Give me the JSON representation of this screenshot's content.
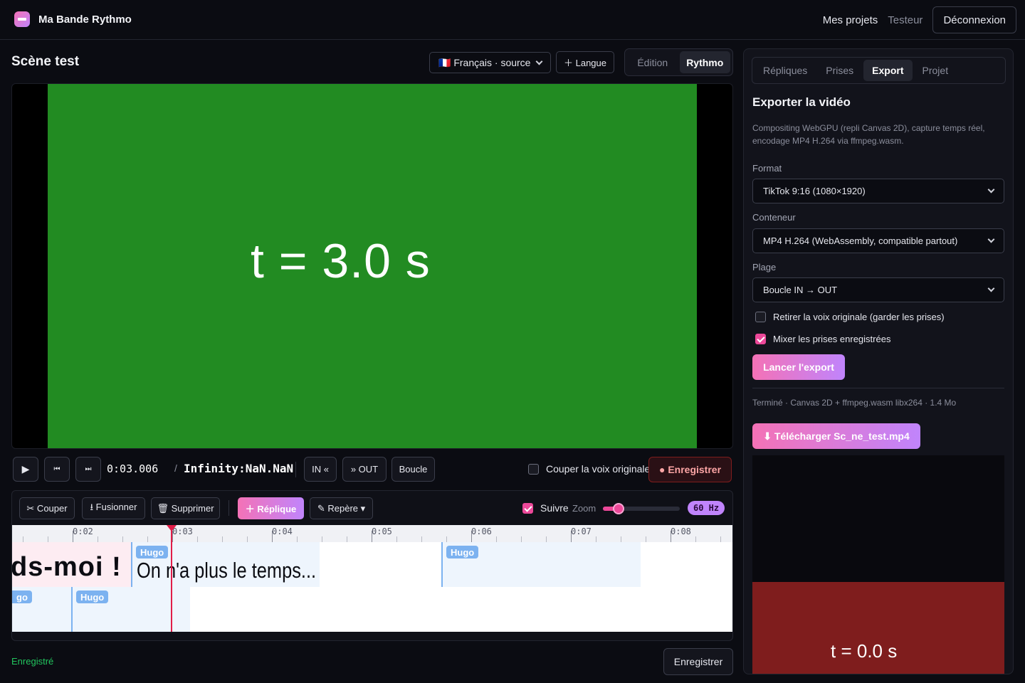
{
  "header": {
    "app_title": "Ma Bande Rythmo",
    "nav_projects": "Mes projets",
    "user_name": "Testeur",
    "logout_label": "Déconnexion"
  },
  "scene": {
    "title": "Scène test",
    "language_select_value": "🇫🇷 Français · source",
    "add_language_label": "＋ Langue",
    "mode_tabs": [
      "Édition",
      "Rythmo"
    ],
    "active_mode": "Rythmo"
  },
  "video": {
    "overlay_text": "t = 3.0 s",
    "background_color": "#228b22"
  },
  "transport": {
    "play_icon": "▶",
    "prev_icon": "⏮",
    "next_icon": "⏭",
    "current_time": "0:03.006",
    "separator": "/",
    "duration": "Infinity:NaN.NaN",
    "in_label": "IN «",
    "out_label": "» OUT",
    "loop_label": "Boucle",
    "mute_original_label": "Couper la voix originale",
    "mute_original_checked": false,
    "record_label": "● Enregistrer"
  },
  "timeline": {
    "cut_label": "✂ Couper",
    "merge_label": "⭳ Fusionner",
    "delete_label": "🗑 Supprimer",
    "add_line_label": "＋ Réplique",
    "marker_label": "✎ Repère ▾",
    "follow_label": "Suivre",
    "follow_checked": true,
    "zoom_label": "Zoom",
    "zoom_level": 0.2,
    "fps_badge": "60 Hz",
    "ruler_ticks": [
      "0:02",
      "0:03",
      "0:04",
      "0:05",
      "0:06",
      "0:07",
      "0:08"
    ],
    "playhead_time": "0:03.006",
    "lane1_text_a": "ds-moi !",
    "lane1_text_b": "On n'a plus le temps...",
    "clip_tag": "Hugo",
    "clip_tag_partial": "go"
  },
  "footer": {
    "save_status": "Enregistré",
    "save_label": "Enregistrer"
  },
  "sidebar": {
    "tabs": [
      "Répliques",
      "Prises",
      "Export",
      "Projet"
    ],
    "active_tab": "Export",
    "export_title": "Exporter la vidéo",
    "export_description": "Compositing WebGPU (repli Canvas 2D), capture temps réel, encodage MP4 H.264 via ffmpeg.wasm.",
    "format_label": "Format",
    "format_value": "TikTok 9:16 (1080×1920)",
    "container_label": "Conteneur",
    "container_value": "MP4 H.264 (WebAssembly, compatible partout)",
    "range_label": "Plage",
    "range_value": "Boucle IN → OUT",
    "remove_voice_label": "Retirer la voix originale (garder les prises)",
    "remove_voice_checked": false,
    "mix_takes_label": "Mixer les prises enregistrées",
    "mix_takes_checked": true,
    "launch_label": "Lancer l'export",
    "export_status": "Terminé · Canvas 2D + ffmpeg.wasm libx264 · 1.4 Mo",
    "download_label": "⬇ Télécharger Sc_ne_test.mp4",
    "preview_text": "t = 0.0 s"
  },
  "colors": {
    "accent_pink": "#ec4899",
    "accent_purple": "#c084fc",
    "playhead": "#e11d48",
    "clip_tag": "#7cb2f0",
    "saved_green": "#22c55e"
  }
}
